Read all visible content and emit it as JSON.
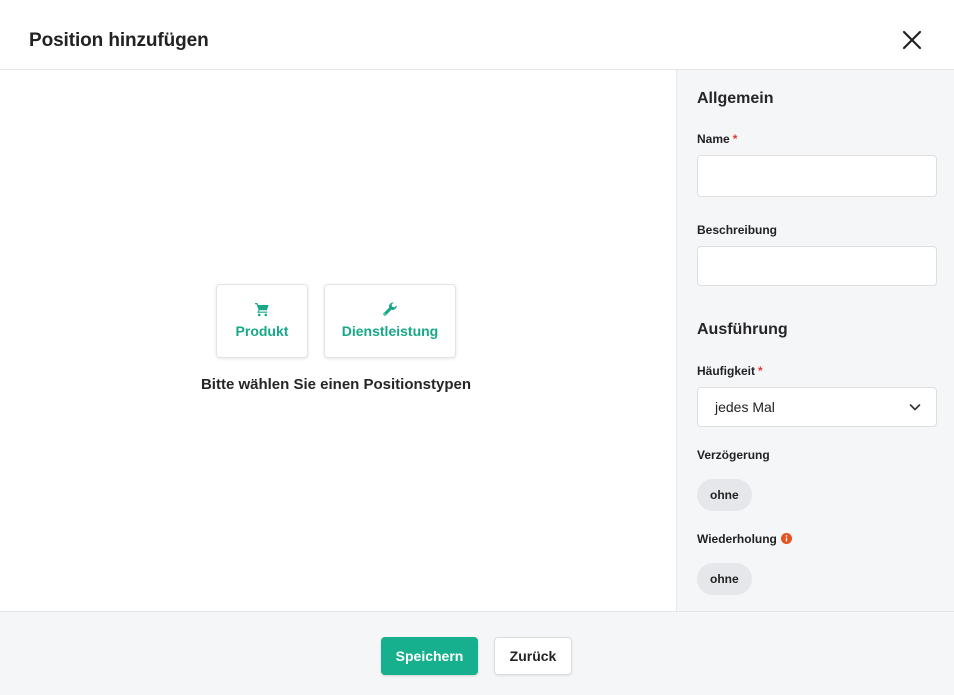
{
  "dialog": {
    "title": "Position hinzufügen",
    "close_icon": "close-icon"
  },
  "type_picker": {
    "cards": [
      {
        "label": "Produkt",
        "icon": "shopping-cart-icon"
      },
      {
        "label": "Dienstleistung",
        "icon": "wrench-icon"
      }
    ],
    "hint": "Bitte wählen Sie einen Positionstypen",
    "accent_color": "#17a889"
  },
  "form": {
    "general": {
      "title": "Allgemein",
      "name_label": "Name",
      "name_value": "",
      "description_label": "Beschreibung",
      "description_value": ""
    },
    "execution": {
      "title": "Ausführung",
      "frequency_label": "Häufigkeit",
      "frequency_value": "jedes Mal",
      "delay_label": "Verzögerung",
      "delay_value": "ohne",
      "repeat_label": "Wiederholung",
      "repeat_value": "ohne",
      "repeat_info_icon": "info-icon"
    },
    "required_marker": "*",
    "required_color": "#e53935",
    "info_color": "#e8501e"
  },
  "footer": {
    "save_label": "Speichern",
    "back_label": "Zurück",
    "primary_color": "#17b08f"
  }
}
